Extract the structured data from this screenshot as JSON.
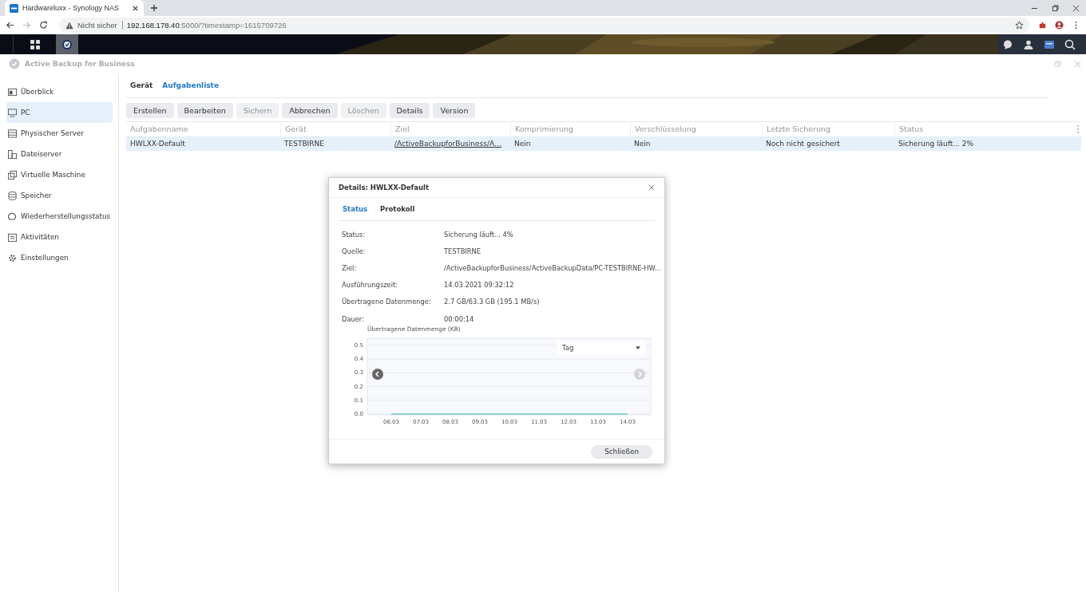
{
  "browser": {
    "tab_title": "Hardwareluxx - Synology NAS",
    "security_label": "Nicht sicher",
    "url_host": "192.168.178.40",
    "url_path": ":5000/?timestamp=1615709726"
  },
  "app": {
    "title": "Active Backup for Business"
  },
  "sidebar": {
    "items": [
      {
        "label": "Überblick",
        "selected": false
      },
      {
        "label": "PC",
        "selected": true
      },
      {
        "label": "Physischer Server",
        "selected": false
      },
      {
        "label": "Dateiserver",
        "selected": false
      },
      {
        "label": "Virtuelle Maschine",
        "selected": false
      },
      {
        "label": "Speicher",
        "selected": false
      },
      {
        "label": "Wiederherstellungsstatus",
        "selected": false
      },
      {
        "label": "Aktivitäten",
        "selected": false
      },
      {
        "label": "Einstellungen",
        "selected": false
      }
    ]
  },
  "tabs": [
    {
      "label": "Gerät",
      "selected": false
    },
    {
      "label": "Aufgabenliste",
      "selected": true
    }
  ],
  "toolbar": [
    {
      "label": "Erstellen",
      "disabled": false
    },
    {
      "label": "Bearbeiten",
      "disabled": false
    },
    {
      "label": "Sichern",
      "disabled": true
    },
    {
      "label": "Abbrechen",
      "disabled": false
    },
    {
      "label": "Löschen",
      "disabled": true
    },
    {
      "label": "Details",
      "disabled": false
    },
    {
      "label": "Version",
      "disabled": false
    }
  ],
  "table": {
    "columns": [
      "Aufgabenname",
      "Gerät",
      "Ziel",
      "Komprimierung",
      "Verschlüsselung",
      "Letzte Sicherung",
      "Status"
    ],
    "rows": [
      {
        "selected": true,
        "cells": [
          {
            "text": "HWLXX-Default",
            "kind": "text"
          },
          {
            "text": "TESTBIRNE",
            "kind": "text"
          },
          {
            "text": "/ActiveBackupforBusiness/A…",
            "kind": "link"
          },
          {
            "text": "Nein",
            "kind": "text"
          },
          {
            "text": "Nein",
            "kind": "text"
          },
          {
            "text": "Noch nicht gesichert",
            "kind": "text"
          },
          {
            "text": "Sicherung läuft... 2%",
            "kind": "text"
          }
        ]
      }
    ]
  },
  "dialog": {
    "title": "Details: HWLXX-Default",
    "tabs": [
      {
        "label": "Status",
        "selected": true
      },
      {
        "label": "Protokoll",
        "selected": false
      }
    ],
    "fields": [
      {
        "label": "Status:",
        "value": "Sicherung läuft... 4%"
      },
      {
        "label": "Quelle:",
        "value": "TESTBIRNE"
      },
      {
        "label": "Ziel:",
        "value": "/ActiveBackupforBusiness/ActiveBackupData/PC-TESTBIRNE-HW..."
      },
      {
        "label": "Ausführungszeit:",
        "value": "14.03.2021 09:32:12"
      },
      {
        "label": "Übertragene Datenmenge:",
        "value": "2.7 GB/63.3 GB (195.1 MB/s)"
      },
      {
        "label": "Dauer:",
        "value": "00:00:14"
      }
    ],
    "chart_data": {
      "type": "line",
      "title": "Übertragene Datenmenge (KB)",
      "categories": [
        "06.03",
        "07.03",
        "08.03",
        "09.03",
        "10.03",
        "11.03",
        "12.03",
        "13.03",
        "14.03"
      ],
      "series": [
        {
          "color": "#8ccfd0",
          "values": [
            0,
            0,
            0,
            0,
            0,
            0,
            0,
            0,
            0
          ]
        }
      ],
      "grid": true,
      "ylim": [
        0,
        0.5
      ],
      "yticks": [
        {
          "value": 0,
          "label": "0.0"
        },
        {
          "value": 0.1,
          "label": "0.1"
        },
        {
          "value": 0.2,
          "label": "0.2"
        },
        {
          "value": 0.3,
          "label": "0.3"
        },
        {
          "value": 0.4,
          "label": "0.4"
        },
        {
          "value": 0.5,
          "label": "0.5"
        }
      ]
    },
    "range_select": "Tag",
    "close_button": "Schließen"
  }
}
